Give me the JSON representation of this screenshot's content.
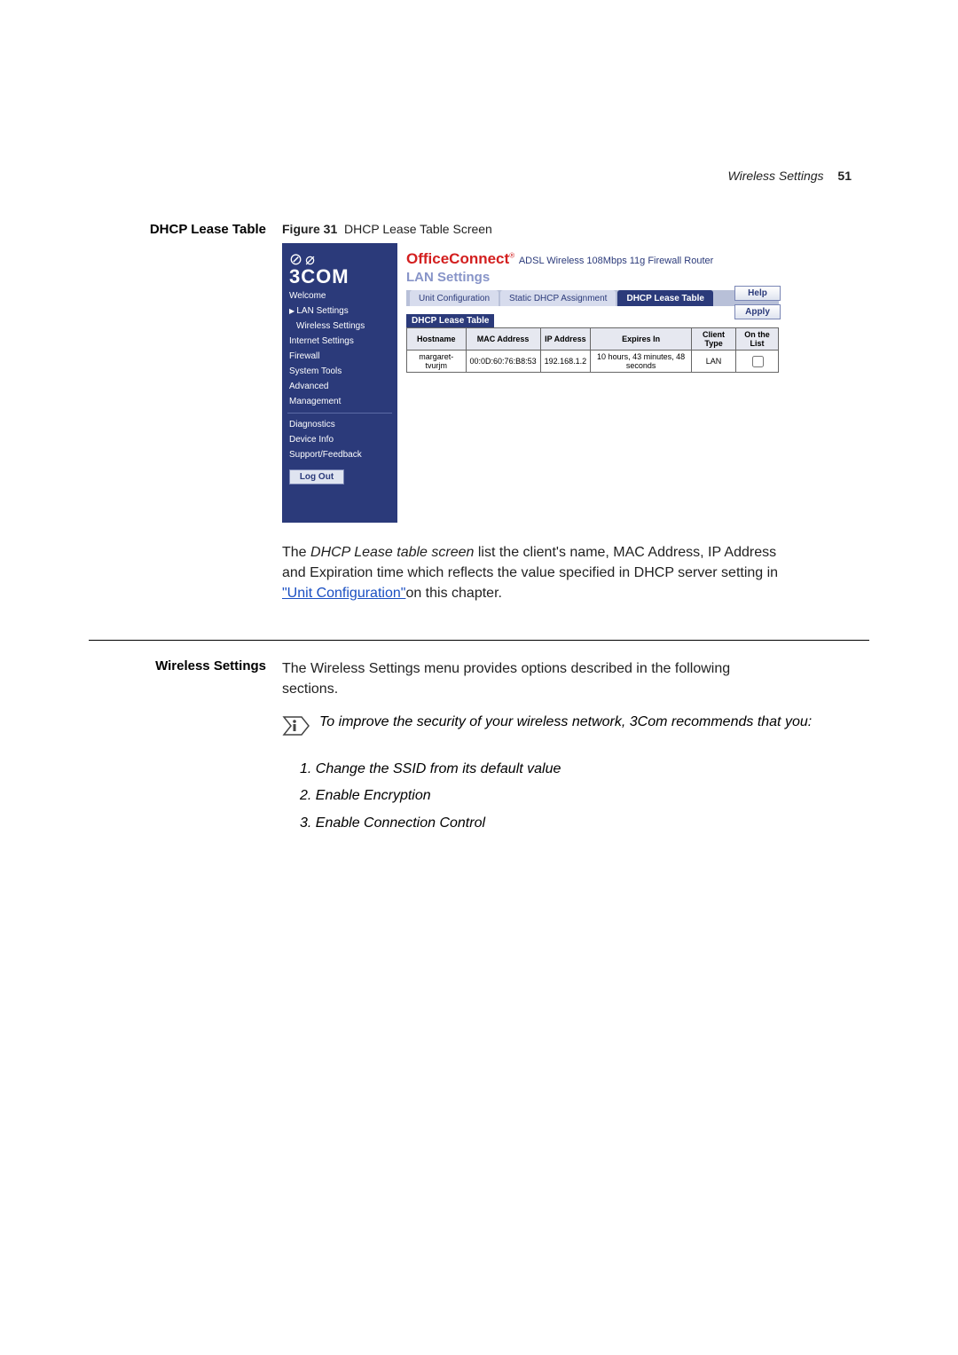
{
  "header": {
    "section": "Wireless Settings",
    "page": "51"
  },
  "fig": {
    "caption_label": "Figure 31",
    "caption": "DHCP Lease Table Screen",
    "left_title": "DHCP Lease Table"
  },
  "shot": {
    "brand_top": "⊘ ⌀",
    "brand": "3COM",
    "title_office": "OfficeConnect",
    "title_reg": "®",
    "title_rest": "ADSL Wireless 108Mbps 11g Firewall Router",
    "subtitle": "LAN Settings",
    "tabs": [
      "Unit Configuration",
      "Static DHCP Assignment",
      "DHCP Lease Table"
    ],
    "table_label": "DHCP Lease Table",
    "columns": [
      "Hostname",
      "MAC Address",
      "IP Address",
      "Expires In",
      "Client Type",
      "On the List"
    ],
    "row": {
      "host": "margaret-tvurjm",
      "mac": "00:0D:60:76:B8:53",
      "ip": "192.168.1.2",
      "exp": "10 hours, 43 minutes, 48 seconds",
      "ctype": "LAN"
    },
    "buttons": {
      "help": "Help",
      "apply": "Apply"
    },
    "nav": {
      "welcome": "Welcome",
      "lan": "LAN Settings",
      "wireless": "Wireless Settings",
      "internet": "Internet Settings",
      "firewall": "Firewall",
      "systools": "System Tools",
      "advanced": "Advanced",
      "management": "Management",
      "diag": "Diagnostics",
      "devinfo": "Device Info",
      "support": "Support/Feedback",
      "logout": "Log Out"
    }
  },
  "para1_a": "The ",
  "para1_i": "DHCP Lease table screen",
  "para1_b": " list the client's name, MAC Address, IP Address and Expiration time which reflects the value specified in DHCP server setting in ",
  "para1_link": "\"Unit Configuration\"",
  "para1_c": "on this chapter.",
  "sec2": {
    "title": "Wireless Settings",
    "text": "The Wireless Settings menu provides options described in the following sections."
  },
  "note": "To improve the security of your wireless network, 3Com recommends that you:",
  "rec": {
    "r1": "1. Change the SSID from its default value",
    "r2": "2. Enable Encryption",
    "r3": "3. Enable Connection Control"
  }
}
